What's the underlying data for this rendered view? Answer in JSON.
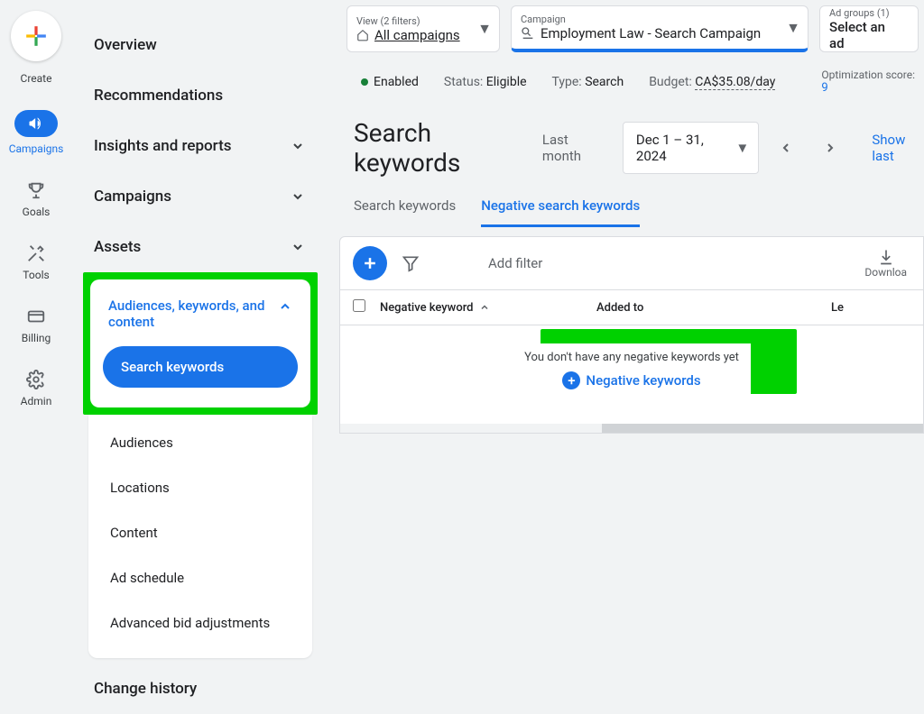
{
  "rail": {
    "create": "Create",
    "campaigns": "Campaigns",
    "goals": "Goals",
    "tools": "Tools",
    "billing": "Billing",
    "admin": "Admin"
  },
  "nav": {
    "overview": "Overview",
    "recommendations": "Recommendations",
    "insights": "Insights and reports",
    "campaigns": "Campaigns",
    "assets": "Assets",
    "akc": "Audiences, keywords, and content",
    "search_keywords": "Search keywords",
    "audiences": "Audiences",
    "locations": "Locations",
    "content": "Content",
    "ad_schedule": "Ad schedule",
    "advanced_bid": "Advanced bid adjustments",
    "change_history": "Change history"
  },
  "selectors": {
    "view_label": "View (2 filters)",
    "view_value": "All campaigns",
    "campaign_label": "Campaign",
    "campaign_value": "Employment Law - Search Campaign",
    "adgroup_label": "Ad groups (1)",
    "adgroup_value": "Select an ad"
  },
  "status": {
    "enabled": "Enabled",
    "status_label": "Status:",
    "status_value": "Eligible",
    "type_label": "Type:",
    "type_value": "Search",
    "budget_label": "Budget:",
    "budget_value": "CA$35.08/day",
    "opt_label": "Optimization score:",
    "opt_value": "9"
  },
  "header": {
    "title": "Search keywords",
    "last_month": "Last month",
    "date_range": "Dec 1 – 31, 2024",
    "show_last": "Show last"
  },
  "tabs": {
    "search": "Search keywords",
    "negative": "Negative search keywords"
  },
  "toolbar": {
    "add_filter": "Add filter",
    "download": "Downloa"
  },
  "table": {
    "col1": "Negative keyword",
    "col2": "Added to",
    "col3": "Le"
  },
  "empty": {
    "msg": "You don't have any negative keywords yet",
    "link": "Negative keywords"
  }
}
